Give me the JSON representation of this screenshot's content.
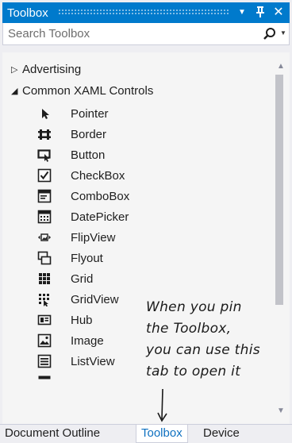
{
  "window": {
    "title": "Toolbox",
    "dropdown_glyph": "▼",
    "pin_glyph": "ᚬ",
    "close_glyph": "✕"
  },
  "search": {
    "placeholder": "Search Toolbox"
  },
  "categories": [
    {
      "label": "Advertising",
      "expanded": false
    },
    {
      "label": "Common XAML Controls",
      "expanded": true
    }
  ],
  "items": [
    {
      "label": "Pointer",
      "icon": "pointer-icon"
    },
    {
      "label": "Border",
      "icon": "border-icon"
    },
    {
      "label": "Button",
      "icon": "button-icon"
    },
    {
      "label": "CheckBox",
      "icon": "checkbox-icon"
    },
    {
      "label": "ComboBox",
      "icon": "combobox-icon"
    },
    {
      "label": "DatePicker",
      "icon": "datepicker-icon"
    },
    {
      "label": "FlipView",
      "icon": "flipview-icon"
    },
    {
      "label": "Flyout",
      "icon": "flyout-icon"
    },
    {
      "label": "Grid",
      "icon": "grid-icon"
    },
    {
      "label": "GridView",
      "icon": "gridview-icon"
    },
    {
      "label": "Hub",
      "icon": "hub-icon"
    },
    {
      "label": "Image",
      "icon": "image-icon"
    },
    {
      "label": "ListView",
      "icon": "listview-icon"
    }
  ],
  "annotation": {
    "lines": [
      "When you pin",
      "the Toolbox,",
      "you can use this",
      "tab to open it"
    ]
  },
  "tabs": [
    {
      "label": "Document Outline",
      "active": false
    },
    {
      "label": "Toolbox",
      "active": true
    },
    {
      "label": "Device",
      "active": false
    }
  ],
  "colors": {
    "accent": "#007acc",
    "panel_background": "#f5f5f5",
    "active_tab_text": "#0e70c0"
  }
}
